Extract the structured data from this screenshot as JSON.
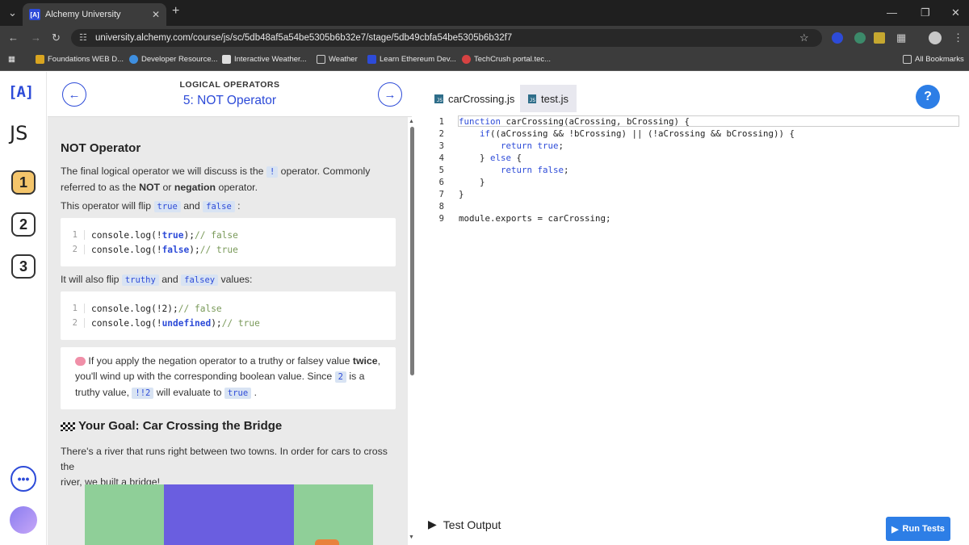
{
  "browser": {
    "tab_title": "Alchemy University",
    "tab_favicon": "[A]",
    "url": "university.alchemy.com/course/js/sc/5db48af5a54be5305b6b32e7/stage/5db49cbfa54be5305b6b32f7",
    "bookmarks": [
      {
        "label": "Foundations WEB D...",
        "icon": "trophy-icon"
      },
      {
        "label": "Developer Resource...",
        "icon": "globe-icon"
      },
      {
        "label": "Interactive Weather...",
        "icon": "page-icon"
      },
      {
        "label": "Weather",
        "icon": "folder-icon"
      },
      {
        "label": "Learn Ethereum Dev...",
        "icon": "alchemy-icon"
      },
      {
        "label": "TechCrush portal.tec...",
        "icon": "techcrush-icon"
      }
    ],
    "all_bookmarks": "All Bookmarks"
  },
  "sidebar": {
    "logo": "[A]",
    "course": "JS",
    "stages": [
      "1",
      "2",
      "3"
    ],
    "more": "•••"
  },
  "lesson_header": {
    "eyebrow": "LOGICAL OPERATORS",
    "title": "5: NOT Operator"
  },
  "lesson": {
    "heading": "NOT Operator",
    "p1_a": "The final logical operator we will discuss is the ",
    "p1_code": "!",
    "p1_b": " operator. Commonly",
    "p1_c": "referred to as the ",
    "p1_not": "NOT",
    "p1_or": " or ",
    "p1_neg": "negation",
    "p1_d": " operator.",
    "p2_a": "This operator will flip ",
    "p2_true": "true",
    "p2_and": " and ",
    "p2_false": "false",
    "p2_b": " :",
    "code1": [
      {
        "n": "1",
        "pre": "console.log(!",
        "kw": "true",
        "post": "); ",
        "cm": "// false"
      },
      {
        "n": "2",
        "pre": "console.log(!",
        "kw": "false",
        "post": "); ",
        "cm": "// true"
      }
    ],
    "p3_a": "It will also flip ",
    "p3_truthy": "truthy",
    "p3_and": " and ",
    "p3_falsey": "falsey",
    "p3_b": " values:",
    "code2": [
      {
        "n": "1",
        "pre": "console.log(!2); ",
        "kw": "",
        "post": "",
        "cm": "// false"
      },
      {
        "n": "2",
        "pre": "console.log(!",
        "kw": "undefined",
        "post": "); ",
        "cm": "// true"
      }
    ],
    "callout_icon": "brain-icon",
    "callout_a": "If you apply the negation operator to a truthy or falsey value ",
    "callout_twice": "twice",
    "callout_b": ",",
    "callout_c": "you'll wind up with the corresponding boolean value. Since ",
    "callout_2": "2",
    "callout_d": " is a",
    "callout_e": "truthy value, ",
    "callout_bang": "!!2",
    "callout_f": " will evaluate to ",
    "callout_true": "true",
    "callout_g": " .",
    "goal_icon": "checkered-flag-icon",
    "goal": "Your Goal: Car Crossing the Bridge",
    "p4_a": "There's a river that runs right between two towns. In order for cars to cross the",
    "p4_b": "river, we built a bridge!"
  },
  "editor": {
    "tabs": [
      "carCrossing.js",
      "test.js"
    ],
    "help": "?",
    "lines": [
      {
        "n": "1",
        "parts": [
          [
            "k",
            "function"
          ],
          [
            "t",
            " carCrossing(aCrossing, bCrossing) {"
          ]
        ]
      },
      {
        "n": "2",
        "parts": [
          [
            "t",
            "    "
          ],
          [
            "k",
            "if"
          ],
          [
            "t",
            "((aCrossing && !bCrossing) || (!aCrossing && bCrossing)) {"
          ]
        ]
      },
      {
        "n": "3",
        "parts": [
          [
            "t",
            "        "
          ],
          [
            "k",
            "return true"
          ],
          [
            "t",
            ";"
          ]
        ]
      },
      {
        "n": "4",
        "parts": [
          [
            "t",
            "    } "
          ],
          [
            "k",
            "else"
          ],
          [
            "t",
            " {"
          ]
        ]
      },
      {
        "n": "5",
        "parts": [
          [
            "t",
            "        "
          ],
          [
            "k",
            "return false"
          ],
          [
            "t",
            ";"
          ]
        ]
      },
      {
        "n": "6",
        "parts": [
          [
            "t",
            "    }"
          ]
        ]
      },
      {
        "n": "7",
        "parts": [
          [
            "t",
            "}"
          ]
        ]
      },
      {
        "n": "8",
        "parts": []
      },
      {
        "n": "9",
        "parts": [
          [
            "t",
            "module.exports = carCrossing;"
          ]
        ]
      }
    ],
    "test_output": "Test Output",
    "run_tests": "Run Tests"
  },
  "colors": {
    "accent": "#2d4bd8",
    "run": "#2d7ee6",
    "scene_green": "#8fcf98",
    "scene_river": "#6a5ee0"
  }
}
